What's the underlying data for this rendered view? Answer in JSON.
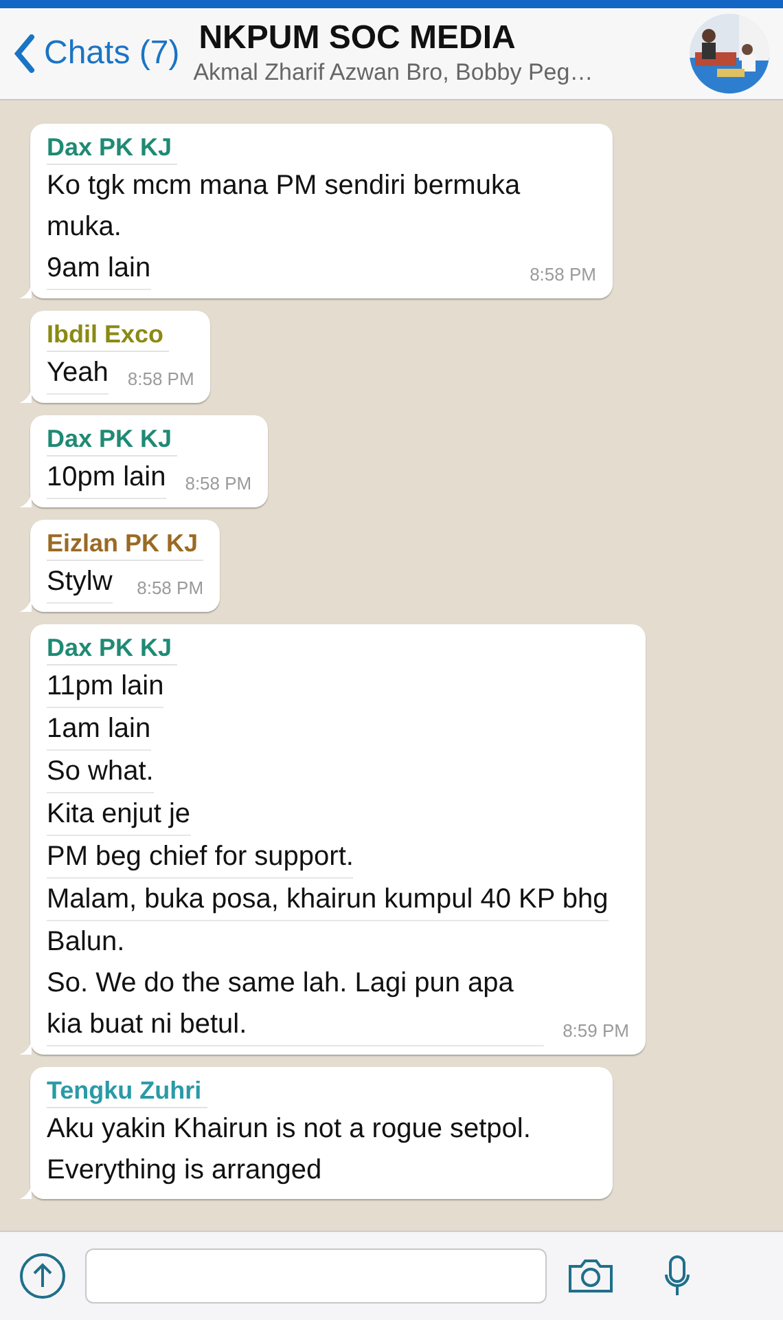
{
  "header": {
    "back_label": "Chats (7)",
    "title": "NKPUM SOC MEDIA",
    "subtitle": "Akmal Zharif Azwan Bro, Bobby Peg…"
  },
  "messages": [
    {
      "sender": "Dax PK KJ",
      "color": "#1f8a74",
      "lines": [
        "Ko tgk mcm mana PM sendiri bermuka muka.",
        "9am lain"
      ],
      "time": "8:58 PM"
    },
    {
      "sender": "Ibdil Exco",
      "color": "#8a8a14",
      "lines": [
        "Yeah"
      ],
      "time": "8:58 PM"
    },
    {
      "sender": "Dax PK KJ",
      "color": "#1f8a74",
      "lines": [
        "10pm lain"
      ],
      "time": "8:58 PM"
    },
    {
      "sender": "Eizlan PK KJ",
      "color": "#9a6a24",
      "lines": [
        "Stylw"
      ],
      "time": "8:58 PM"
    },
    {
      "sender": "Dax PK KJ",
      "color": "#1f8a74",
      "lines": [
        "11pm lain",
        "1am lain",
        "So what.",
        "Kita enjut je",
        "PM beg chief for support.",
        "Malam, buka posa, khairun kumpul 40 KP bhg",
        "Balun.",
        "So. We do the same lah. Lagi pun apa kia buat ni betul."
      ],
      "time": "8:59 PM"
    },
    {
      "sender": "Tengku Zuhri",
      "color": "#2a9aa6",
      "lines": [
        "Aku yakin Khairun is not a rogue setpol. Everything is arranged"
      ]
    }
  ]
}
